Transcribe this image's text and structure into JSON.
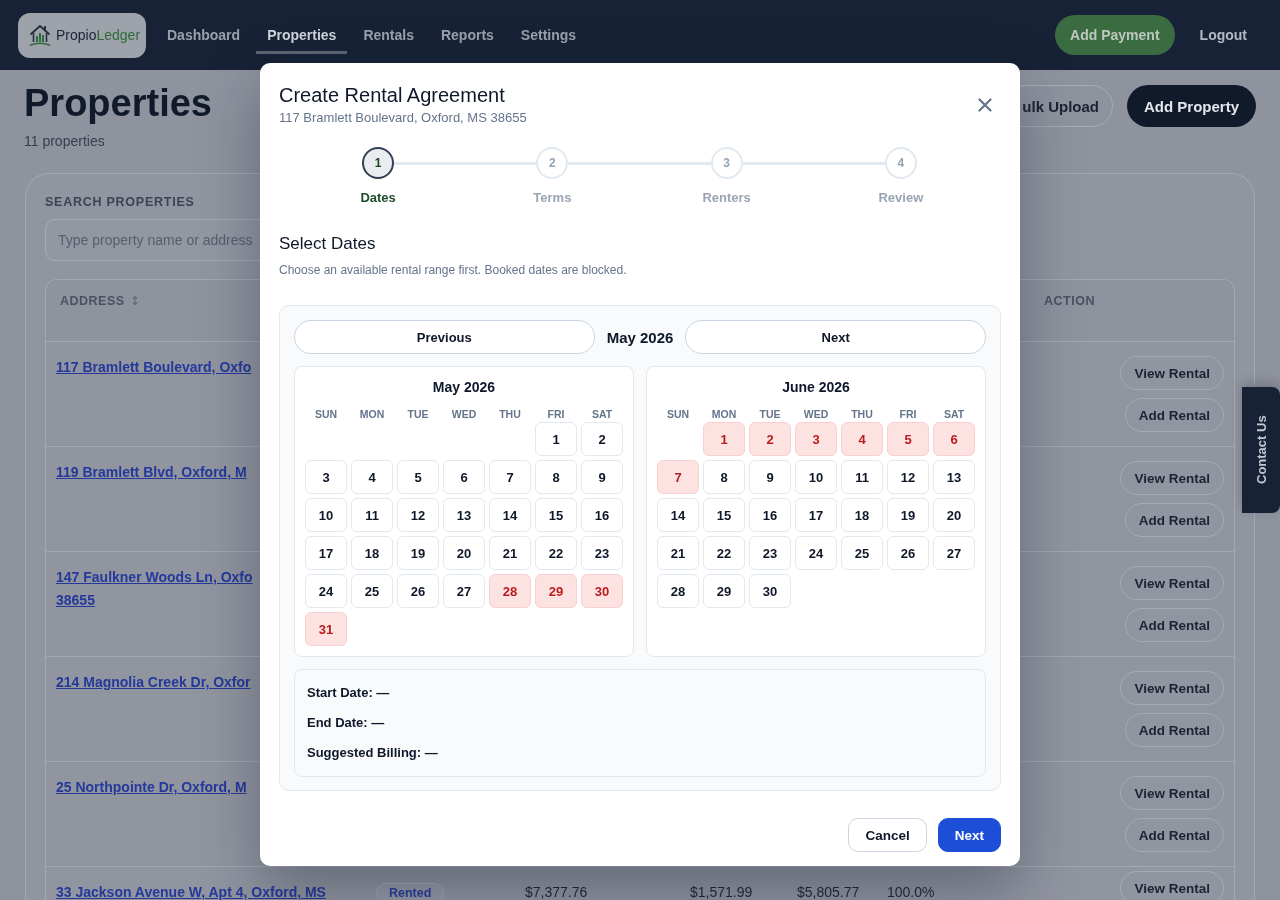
{
  "nav": {
    "brand": [
      "Propio",
      "Ledger"
    ],
    "links": [
      {
        "label": "Dashboard",
        "selected": false
      },
      {
        "label": "Properties",
        "selected": true
      },
      {
        "label": "Rentals",
        "selected": false
      },
      {
        "label": "Reports",
        "selected": false
      },
      {
        "label": "Settings",
        "selected": false
      }
    ],
    "actions": [
      {
        "label": "Add Payment",
        "kind": "primary"
      },
      {
        "label": "Logout",
        "kind": "link"
      }
    ]
  },
  "page": {
    "title": "Properties",
    "count": "11 properties",
    "buttons": [
      {
        "label": "ulk Upload",
        "kind": "outline"
      },
      {
        "label": "Add Property",
        "kind": "solid"
      }
    ]
  },
  "search": {
    "label": "SEARCH PROPERTIES",
    "placeholder": "Type property name or address"
  },
  "table": {
    "columns": [
      {
        "label": "ADDRESS",
        "kind": "address",
        "sort_icon": "↕"
      },
      {
        "label": "ACTION",
        "kind": "action"
      }
    ],
    "rows": [
      {
        "address": [
          "117 Bramlett Boulevard, Oxfo"
        ],
        "actions": [
          "View Rental",
          "Add Rental"
        ]
      },
      {
        "address": [
          "119 Bramlett Blvd, Oxford, M"
        ],
        "actions": [
          "View Rental",
          "Add Rental"
        ]
      },
      {
        "address": [
          "147 Faulkner Woods Ln, Oxfo",
          "38655"
        ],
        "actions": [
          "View Rental",
          "Add Rental"
        ]
      },
      {
        "address": [
          "214 Magnolia Creek Dr, Oxfor"
        ],
        "actions": [
          "View Rental",
          "Add Rental"
        ]
      },
      {
        "address": [
          "25 Northpointe Dr, Oxford, M"
        ],
        "actions": [
          "View Rental",
          "Add Rental"
        ]
      },
      {
        "address": [
          "33 Jackson Avenue W, Apt 4, Oxford, MS"
        ],
        "status": "Rented",
        "values": [
          "$7,377.76",
          "$1,571.99",
          "$5,805.77",
          "100.0%"
        ],
        "actions": [
          "View Rental"
        ]
      }
    ]
  },
  "contact_tab": {
    "label": "Contact Us"
  },
  "modal": {
    "title": "Create Rental Agreement",
    "subtitle": "117 Bramlett Boulevard, Oxford, MS 38655",
    "steps": [
      {
        "number": "1",
        "label": "Dates",
        "active": true
      },
      {
        "number": "2",
        "label": "Terms",
        "active": false
      },
      {
        "number": "3",
        "label": "Renters",
        "active": false
      },
      {
        "number": "4",
        "label": "Review",
        "active": false
      }
    ],
    "section": {
      "title": "Select Dates",
      "hint": "Choose an available rental range first. Booked dates are blocked."
    },
    "calendar": {
      "nav": {
        "previous": "Previous",
        "current": "May 2026",
        "next": "Next"
      },
      "months": [
        {
          "title": "May 2026",
          "weekdays": [
            "SUN",
            "MON",
            "TUE",
            "WED",
            "THU",
            "FRI",
            "SAT"
          ],
          "weeks": [
            {
              "kind": "leading",
              "days": [
                {
                  "label": "1",
                  "booked": false
                },
                {
                  "label": "2",
                  "booked": false
                }
              ]
            },
            {
              "kind": "regular",
              "days": [
                {
                  "label": "3",
                  "booked": false
                },
                {
                  "label": "4",
                  "booked": false
                },
                {
                  "label": "5",
                  "booked": false
                },
                {
                  "label": "6",
                  "booked": false
                },
                {
                  "label": "7",
                  "booked": false
                },
                {
                  "label": "8",
                  "booked": false
                },
                {
                  "label": "9",
                  "booked": false
                }
              ]
            },
            {
              "kind": "regular",
              "days": [
                {
                  "label": "10",
                  "booked": false
                },
                {
                  "label": "11",
                  "booked": false
                },
                {
                  "label": "12",
                  "booked": false
                },
                {
                  "label": "13",
                  "booked": false
                },
                {
                  "label": "14",
                  "booked": false
                },
                {
                  "label": "15",
                  "booked": false
                },
                {
                  "label": "16",
                  "booked": false
                }
              ]
            },
            {
              "kind": "regular",
              "days": [
                {
                  "label": "17",
                  "booked": false
                },
                {
                  "label": "18",
                  "booked": false
                },
                {
                  "label": "19",
                  "booked": false
                },
                {
                  "label": "20",
                  "booked": false
                },
                {
                  "label": "21",
                  "booked": false
                },
                {
                  "label": "22",
                  "booked": false
                },
                {
                  "label": "23",
                  "booked": false
                }
              ]
            },
            {
              "kind": "regular",
              "days": [
                {
                  "label": "24",
                  "booked": false
                },
                {
                  "label": "25",
                  "booked": false
                },
                {
                  "label": "26",
                  "booked": false
                },
                {
                  "label": "27",
                  "booked": false
                },
                {
                  "label": "28",
                  "booked": true
                },
                {
                  "label": "29",
                  "booked": true
                },
                {
                  "label": "30",
                  "booked": true
                }
              ]
            },
            {
              "kind": "regular",
              "days": [
                {
                  "label": "31",
                  "booked": true
                }
              ]
            }
          ]
        },
        {
          "title": "June 2026",
          "weekdays": [
            "SUN",
            "MON",
            "TUE",
            "WED",
            "THU",
            "FRI",
            "SAT"
          ],
          "weeks": [
            {
              "kind": "leading",
              "days": [
                {
                  "label": "1",
                  "booked": true
                },
                {
                  "label": "2",
                  "booked": true
                },
                {
                  "label": "3",
                  "booked": true
                },
                {
                  "label": "4",
                  "booked": true
                },
                {
                  "label": "5",
                  "booked": true
                },
                {
                  "label": "6",
                  "booked": true
                }
              ]
            },
            {
              "kind": "regular",
              "days": [
                {
                  "label": "7",
                  "booked": true
                },
                {
                  "label": "8",
                  "booked": false
                },
                {
                  "label": "9",
                  "booked": false
                },
                {
                  "label": "10",
                  "booked": false
                },
                {
                  "label": "11",
                  "booked": false
                },
                {
                  "label": "12",
                  "booked": false
                },
                {
                  "label": "13",
                  "booked": false
                }
              ]
            },
            {
              "kind": "regular",
              "days": [
                {
                  "label": "14",
                  "booked": false
                },
                {
                  "label": "15",
                  "booked": false
                },
                {
                  "label": "16",
                  "booked": false
                },
                {
                  "label": "17",
                  "booked": false
                },
                {
                  "label": "18",
                  "booked": false
                },
                {
                  "label": "19",
                  "booked": false
                },
                {
                  "label": "20",
                  "booked": false
                }
              ]
            },
            {
              "kind": "regular",
              "days": [
                {
                  "label": "21",
                  "booked": false
                },
                {
                  "label": "22",
                  "booked": false
                },
                {
                  "label": "23",
                  "booked": false
                },
                {
                  "label": "24",
                  "booked": false
                },
                {
                  "label": "25",
                  "booked": false
                },
                {
                  "label": "26",
                  "booked": false
                },
                {
                  "label": "27",
                  "booked": false
                }
              ]
            },
            {
              "kind": "regular",
              "days": [
                {
                  "label": "28",
                  "booked": false
                },
                {
                  "label": "29",
                  "booked": false
                },
                {
                  "label": "30",
                  "booked": false
                }
              ]
            }
          ]
        }
      ]
    },
    "summary": [
      "Start Date: —",
      "End Date: —",
      "Suggested Billing: —"
    ],
    "buttons": [
      {
        "label": "Cancel",
        "kind": "secondary"
      },
      {
        "label": "Next",
        "kind": "primary"
      }
    ]
  }
}
